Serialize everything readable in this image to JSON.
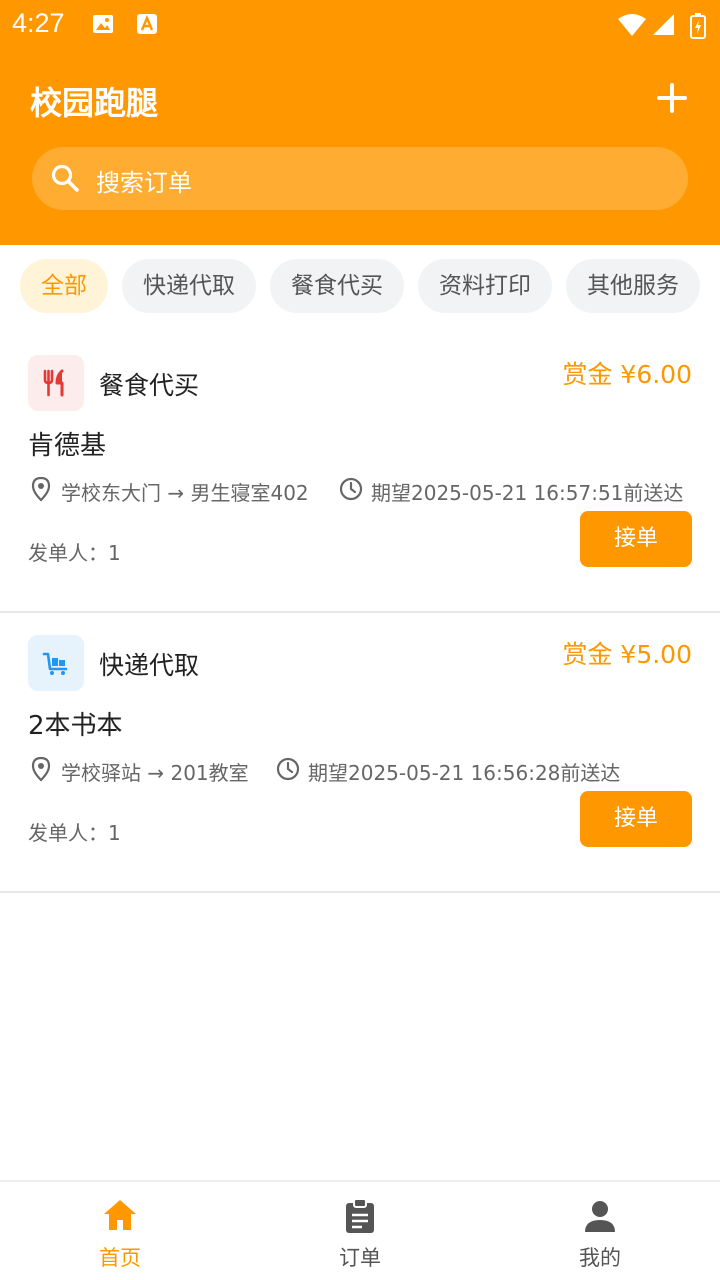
{
  "status_bar": {
    "time": "4:27"
  },
  "header": {
    "title": "校园跑腿"
  },
  "search": {
    "placeholder": "搜索订单"
  },
  "categories": [
    {
      "label": "全部",
      "active": true
    },
    {
      "label": "快递代取",
      "active": false
    },
    {
      "label": "餐食代买",
      "active": false
    },
    {
      "label": "资料打印",
      "active": false
    },
    {
      "label": "其他服务",
      "active": false
    }
  ],
  "orders": [
    {
      "category": "餐食代买",
      "category_icon": "fork-knife-icon",
      "reward": "赏金 ¥6.00",
      "title": "肯德基",
      "route": "学校东大门 → 男生寝室402",
      "expected": "期望2025-05-21 16:57:51前送达",
      "sender": "发单人：1",
      "accept_label": "接单"
    },
    {
      "category": "快递代取",
      "category_icon": "cart-icon",
      "reward": "赏金 ¥5.00",
      "title": "2本书本",
      "route": "学校驿站 → 201教室",
      "expected": "期望2025-05-21 16:56:28前送达",
      "sender": "发单人：1",
      "accept_label": "接单"
    }
  ],
  "bottom_nav": [
    {
      "label": "首页",
      "icon": "home-icon",
      "active": true
    },
    {
      "label": "订单",
      "icon": "clipboard-icon",
      "active": false
    },
    {
      "label": "我的",
      "icon": "person-icon",
      "active": false
    }
  ],
  "colors": {
    "primary": "#ff9800",
    "chip_active_bg": "#fff3d8",
    "chip_bg": "#f2f3f5"
  }
}
